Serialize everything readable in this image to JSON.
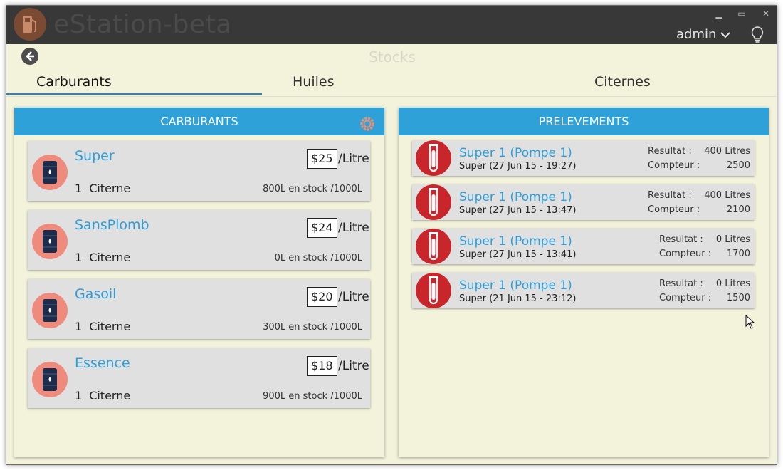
{
  "window": {
    "app_title": "eStation-beta",
    "minimize_glyph": "▁",
    "maximize_glyph": "▭",
    "close_glyph": "✕",
    "user": "admin",
    "page_title": "Stocks"
  },
  "tabs": [
    {
      "label": "Carburants",
      "active": true
    },
    {
      "label": "Huiles",
      "active": false
    },
    {
      "label": "Citernes",
      "active": false
    }
  ],
  "carburants": {
    "header": "CARBURANTS",
    "items": [
      {
        "name": "Super",
        "price": "$25",
        "unit": "/Litre",
        "citerne_count": "1",
        "citerne_label": "Citerne",
        "stock": "800L en stock /1000L"
      },
      {
        "name": "SansPlomb",
        "price": "$24",
        "unit": "/Litre",
        "citerne_count": "1",
        "citerne_label": "Citerne",
        "stock": "0L en stock /1000L"
      },
      {
        "name": "Gasoil",
        "price": "$20",
        "unit": "/Litre",
        "citerne_count": "1",
        "citerne_label": "Citerne",
        "stock": "300L en stock /1000L"
      },
      {
        "name": "Essence",
        "price": "$18",
        "unit": "/Litre",
        "citerne_count": "1",
        "citerne_label": "Citerne",
        "stock": "900L en stock /1000L"
      }
    ]
  },
  "prelevements": {
    "header": "PRELEVEMENTS",
    "items": [
      {
        "title": "Super 1 (Pompe 1)",
        "subtitle": "Super (27 Jun 15 - 19:27)",
        "resultat_label": "Resultat :",
        "resultat": "400 Litres",
        "compteur_label": "Compteur :",
        "compteur": "2500"
      },
      {
        "title": "Super 1 (Pompe 1)",
        "subtitle": "Super (27 Jun 15 - 13:47)",
        "resultat_label": "Resultat :",
        "resultat": "400 Litres",
        "compteur_label": "Compteur :",
        "compteur": "2100"
      },
      {
        "title": "Super 1 (Pompe 1)",
        "subtitle": "Super (27 Jun 15 - 13:41)",
        "resultat_label": "Resultat :",
        "resultat": "0 Litres",
        "compteur_label": "Compteur :",
        "compteur": "1700"
      },
      {
        "title": "Super 1 (Pompe 1)",
        "subtitle": "Super (21 Jun 15 - 23:12)",
        "resultat_label": "Resultat :",
        "resultat": "0 Litres",
        "compteur_label": "Compteur :",
        "compteur": "1500"
      }
    ]
  },
  "colors": {
    "accent": "#2ea1d8",
    "titlebar": "#383838",
    "background": "#f3f3dc",
    "fuel_icon": "#ef8b7c",
    "sample_icon": "#c8262b"
  },
  "icons": {
    "app_logo": "fuel-pump-icon",
    "back": "back-arrow-icon",
    "user_menu": "chevron-down-icon",
    "help": "lightbulb-icon",
    "panel_settings": "gear-icon",
    "fuel": "oil-barrel-icon",
    "sample": "test-tube-icon"
  }
}
